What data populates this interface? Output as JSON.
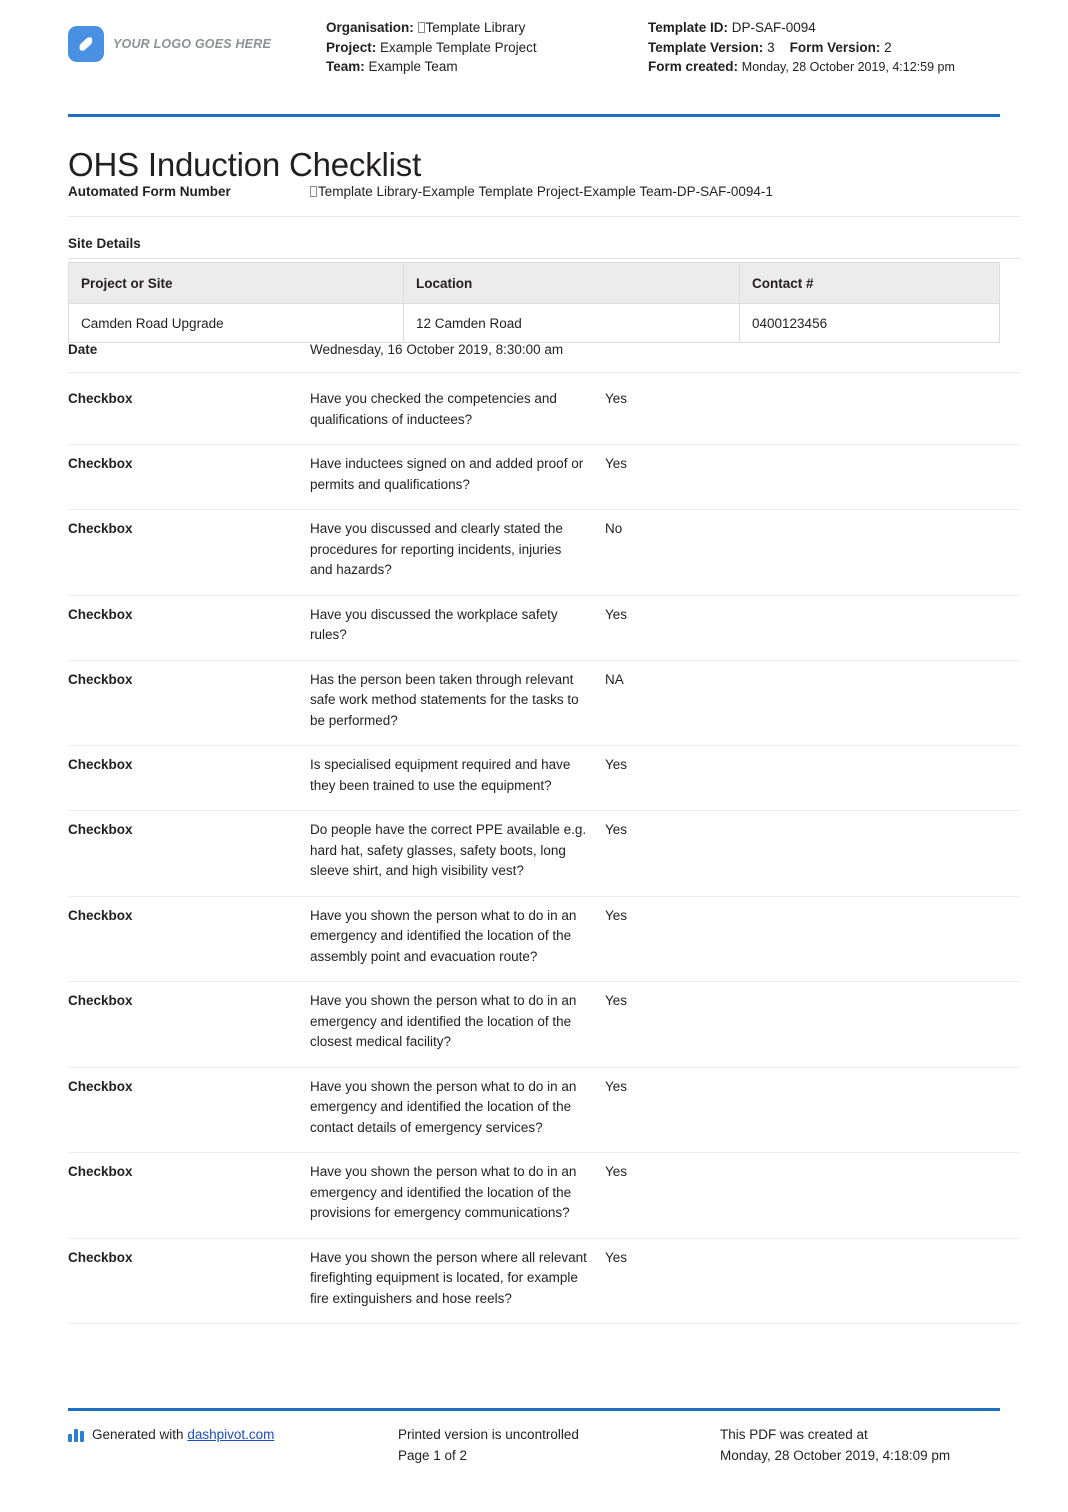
{
  "header": {
    "logo_text": "YOUR LOGO GOES HERE",
    "organisation_label": "Organisation:",
    "organisation_value": "Template Library",
    "project_label": "Project:",
    "project_value": "Example Template Project",
    "team_label": "Team:",
    "team_value": "Example Team",
    "template_id_label": "Template ID:",
    "template_id_value": "DP-SAF-0094",
    "template_version_label": "Template Version:",
    "template_version_value": "3",
    "form_version_label": "Form Version:",
    "form_version_value": "2",
    "form_created_label": "Form created:",
    "form_created_value": "Monday, 28 October 2019, 4:12:59 pm"
  },
  "title": "OHS Induction Checklist",
  "form_number": {
    "label": "Automated Form Number",
    "value": "Template Library-Example Template Project-Example Team-DP-SAF-0094-1"
  },
  "site_details": {
    "section_title": "Site Details",
    "columns": [
      "Project or Site",
      "Location",
      "Contact #"
    ],
    "rows": [
      [
        "Camden Road Upgrade",
        "12 Camden Road",
        "0400123456"
      ]
    ]
  },
  "date_field": {
    "label": "Date",
    "value": "Wednesday, 16 October 2019, 8:30:00 am"
  },
  "checklist": {
    "rows": [
      {
        "type": "Checkbox",
        "question": "Have you checked the competencies and qualifications of inductees?",
        "answer": "Yes"
      },
      {
        "type": "Checkbox",
        "question": "Have inductees signed on and added proof or permits and qualifications?",
        "answer": "Yes"
      },
      {
        "type": "Checkbox",
        "question": "Have you discussed and clearly stated the procedures for reporting incidents, injuries and hazards?",
        "answer": "No"
      },
      {
        "type": "Checkbox",
        "question": "Have you discussed the workplace safety rules?",
        "answer": "Yes"
      },
      {
        "type": "Checkbox",
        "question": "Has the person been taken through relevant safe work method statements for the tasks to be performed?",
        "answer": "NA"
      },
      {
        "type": "Checkbox",
        "question": "Is specialised equipment required and have they been trained to use the equipment?",
        "answer": "Yes"
      },
      {
        "type": "Checkbox",
        "question": "Do people have the correct PPE available e.g. hard hat, safety glasses, safety boots, long sleeve shirt, and high visibility vest?",
        "answer": "Yes"
      },
      {
        "type": "Checkbox",
        "question": "Have you shown the person what to do in an emergency and identified the location of the assembly point and evacuation route?",
        "answer": "Yes"
      },
      {
        "type": "Checkbox",
        "question": "Have you shown the person what to do in an emergency and identified the location of the closest medical facility?",
        "answer": "Yes"
      },
      {
        "type": "Checkbox",
        "question": "Have you shown the person what to do in an emergency and identified the location of the contact details of emergency services?",
        "answer": "Yes"
      },
      {
        "type": "Checkbox",
        "question": "Have you shown the person what to do in an emergency and identified the location of the provisions for emergency communications?",
        "answer": "Yes"
      },
      {
        "type": "Checkbox",
        "question": "Have you shown the person where all relevant firefighting equipment is located, for example fire extinguishers and hose reels?",
        "answer": "Yes"
      }
    ]
  },
  "footer": {
    "generated_prefix": "Generated with ",
    "generated_link": "dashpivot.com",
    "printed_notice": "Printed version is uncontrolled",
    "page_label": "Page 1 of 2",
    "pdf_created_label": "This PDF was created at",
    "pdf_created_value": "Monday, 28 October 2019, 4:18:09 pm"
  },
  "colors": {
    "accent_blue": "#1f6fc4",
    "logo_blue": "#4a90e2",
    "link_blue": "#1a4fbf",
    "table_header_bg": "#ececec"
  }
}
